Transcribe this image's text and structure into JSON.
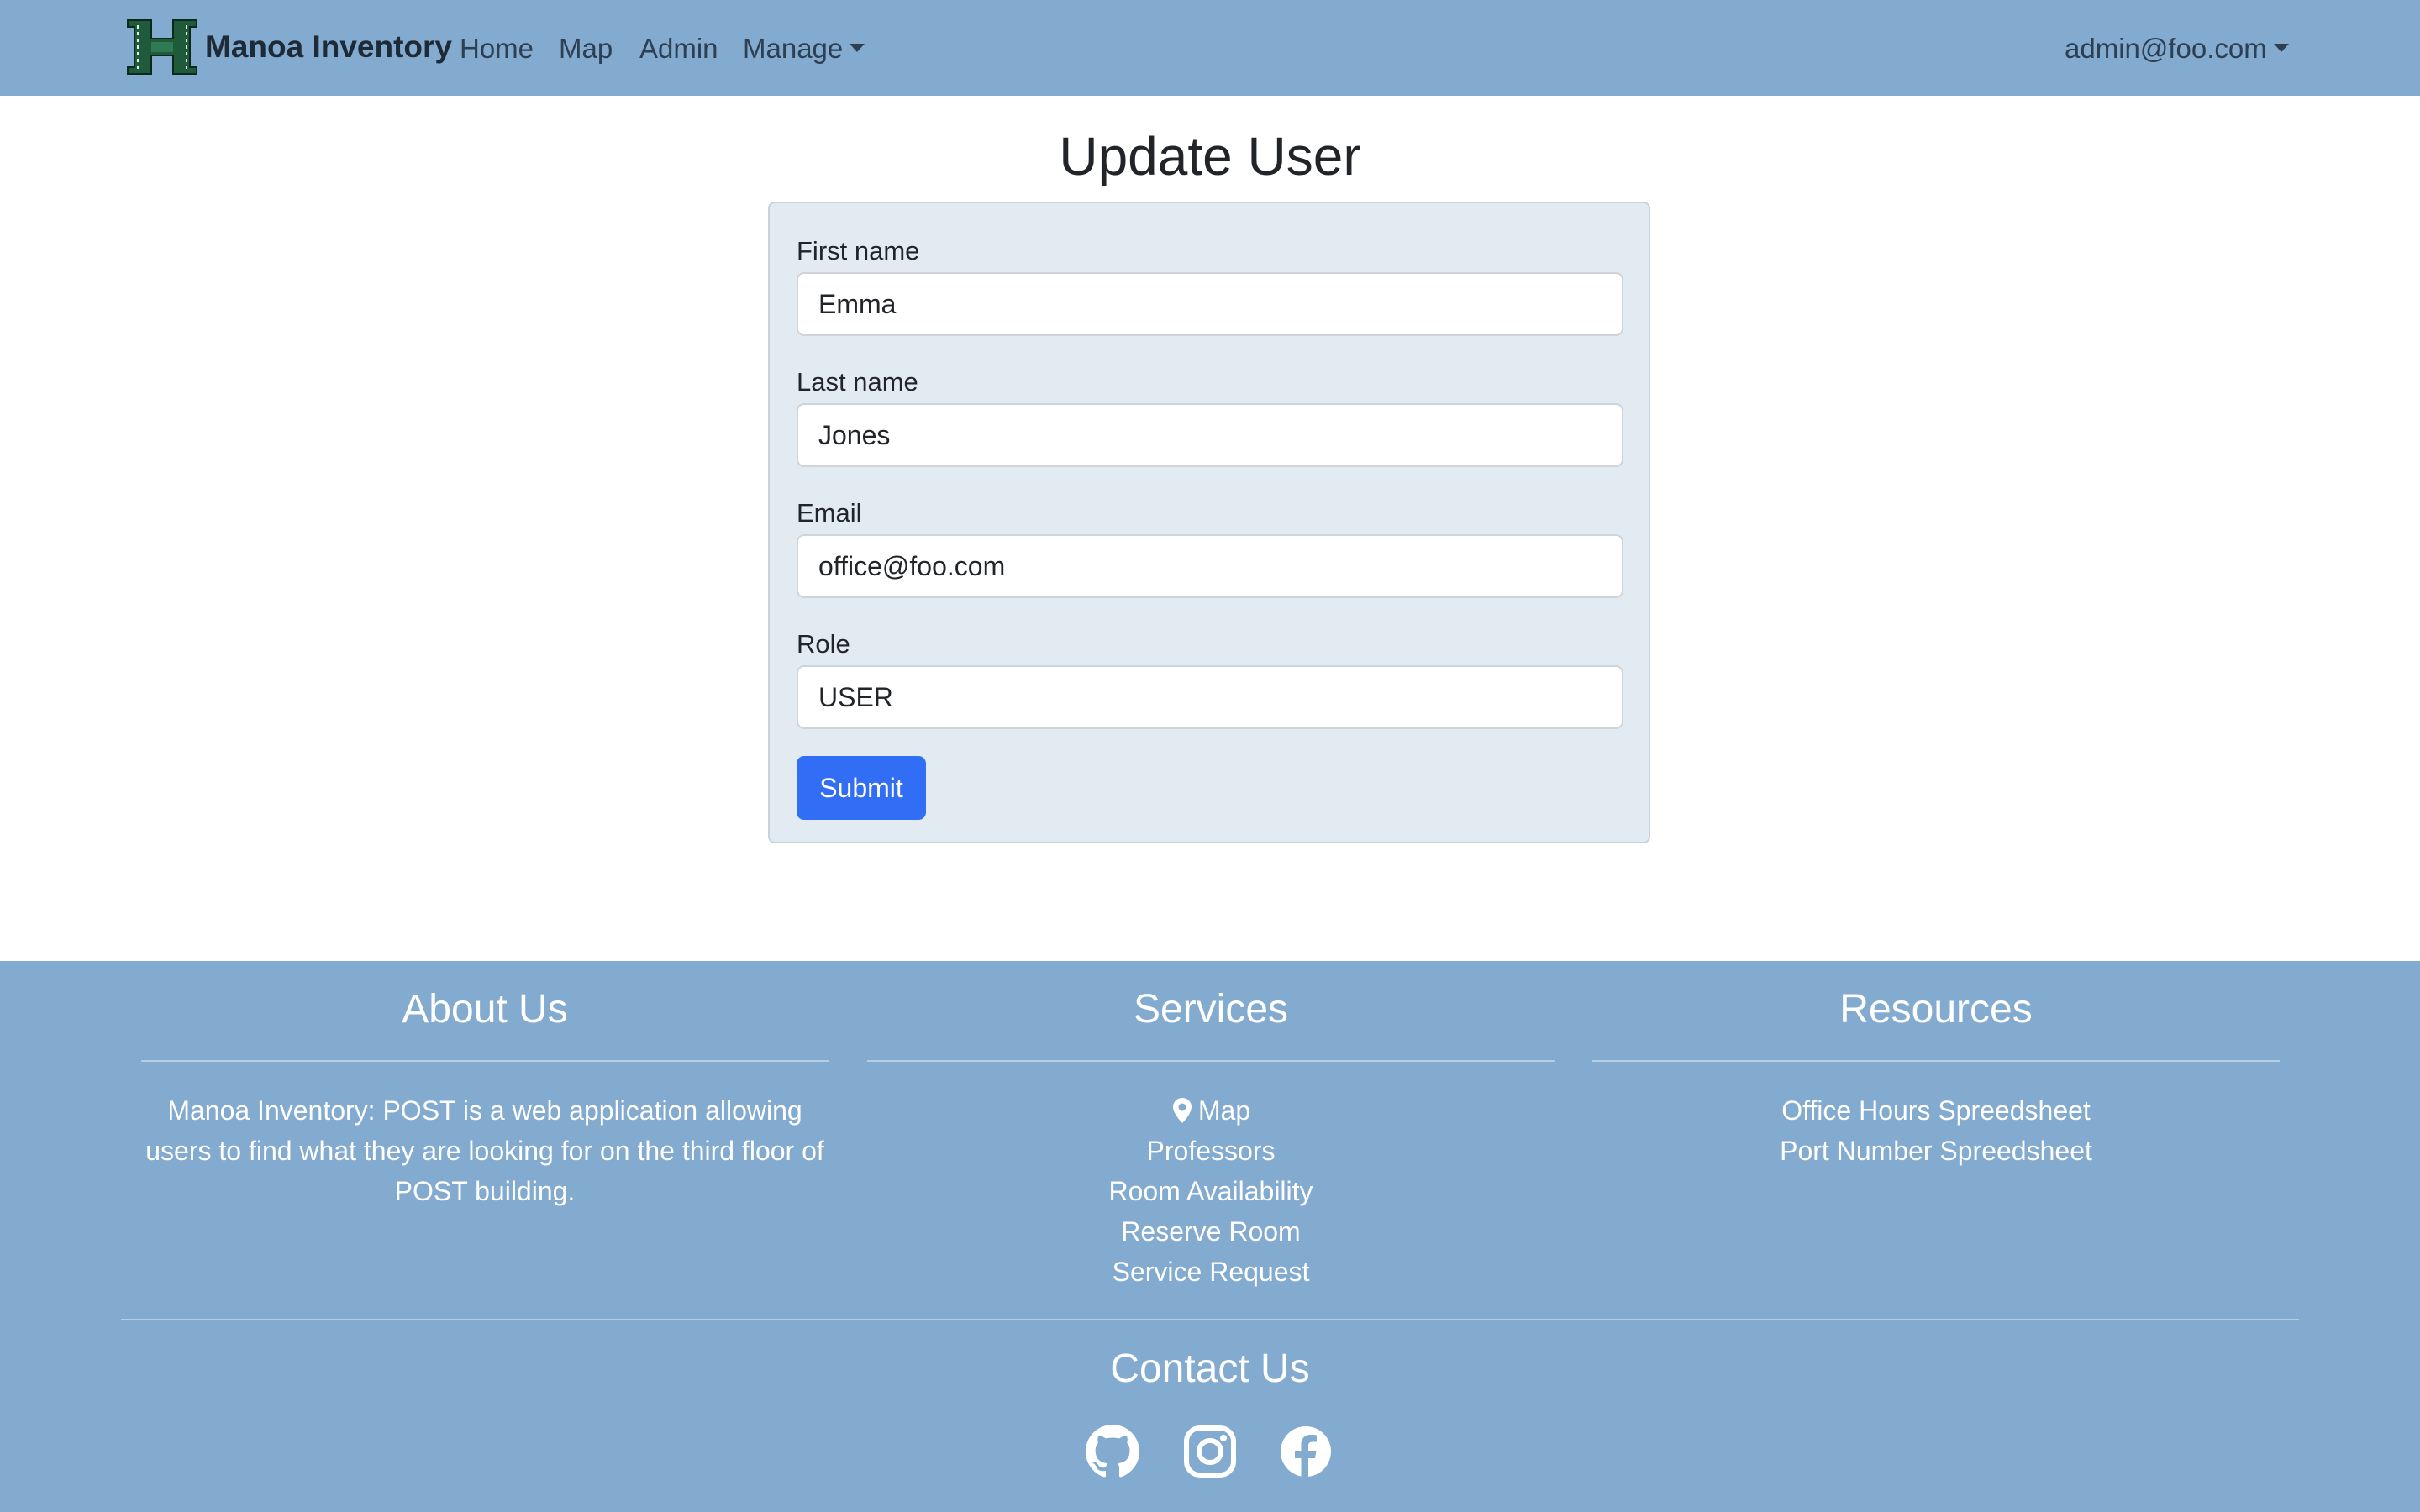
{
  "navbar": {
    "brand": "Manoa Inventory",
    "links": [
      "Home",
      "Map",
      "Admin"
    ],
    "manage_label": "Manage",
    "user_menu": "admin@foo.com"
  },
  "main": {
    "title": "Update User",
    "form": {
      "first_name_label": "First name",
      "first_name_value": "Emma",
      "last_name_label": "Last name",
      "last_name_value": "Jones",
      "email_label": "Email",
      "email_value": "office@foo.com",
      "role_label": "Role",
      "role_value": "USER",
      "submit_label": "Submit"
    }
  },
  "footer": {
    "about": {
      "title": "About Us",
      "text": "Manoa Inventory: POST is a web application allowing users to find what they are looking for on the third floor of POST building."
    },
    "services": {
      "title": "Services",
      "items": [
        "Map",
        "Professors",
        "Room Availability",
        "Reserve Room",
        "Service Request"
      ]
    },
    "resources": {
      "title": "Resources",
      "items": [
        "Office Hours Spreedsheet",
        "Port Number Spreedsheet"
      ]
    },
    "contact": {
      "title": "Contact Us",
      "icons": [
        "github-icon",
        "instagram-icon",
        "facebook-icon"
      ]
    }
  },
  "colors": {
    "navbar_bg": "#83aacf",
    "card_bg": "#e2eaf2",
    "primary_button": "#316ef5"
  }
}
